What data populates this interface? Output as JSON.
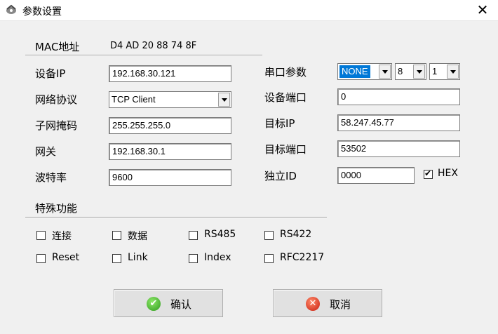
{
  "window": {
    "title": "参数设置",
    "close_glyph": "✕"
  },
  "mac": {
    "label": "MAC地址",
    "value": "D4 AD 20 88 74 8F"
  },
  "left_fields": {
    "device_ip": {
      "label": "设备IP",
      "value": "192.168.30.121"
    },
    "protocol": {
      "label": "网络协议",
      "value": "TCP Client"
    },
    "subnet": {
      "label": "子网掩码",
      "value": "255.255.255.0"
    },
    "gateway": {
      "label": "网关",
      "value": "192.168.30.1"
    },
    "baud": {
      "label": "波特率",
      "value": "9600"
    }
  },
  "right_fields": {
    "serial": {
      "label": "串口参数",
      "parity": "NONE",
      "data_bits": "8",
      "stop_bits": "1"
    },
    "device_port": {
      "label": "设备端口",
      "value": "0"
    },
    "target_ip": {
      "label": "目标IP",
      "value": "58.247.45.77"
    },
    "target_port": {
      "label": "目标端口",
      "value": "53502"
    },
    "independent_id": {
      "label": "独立ID",
      "value": "0000"
    },
    "hex": {
      "label": "HEX",
      "checked": true
    }
  },
  "special": {
    "label": "特殊功能",
    "options": {
      "connect": "连接",
      "data": "数据",
      "rs485": "RS485",
      "rs422": "RS422",
      "reset": "Reset",
      "link": "Link",
      "index": "Index",
      "rfc2217": "RFC2217"
    }
  },
  "buttons": {
    "ok": "确认",
    "cancel": "取消",
    "ok_icon": "checkmark-icon",
    "cancel_icon": "x-icon"
  }
}
